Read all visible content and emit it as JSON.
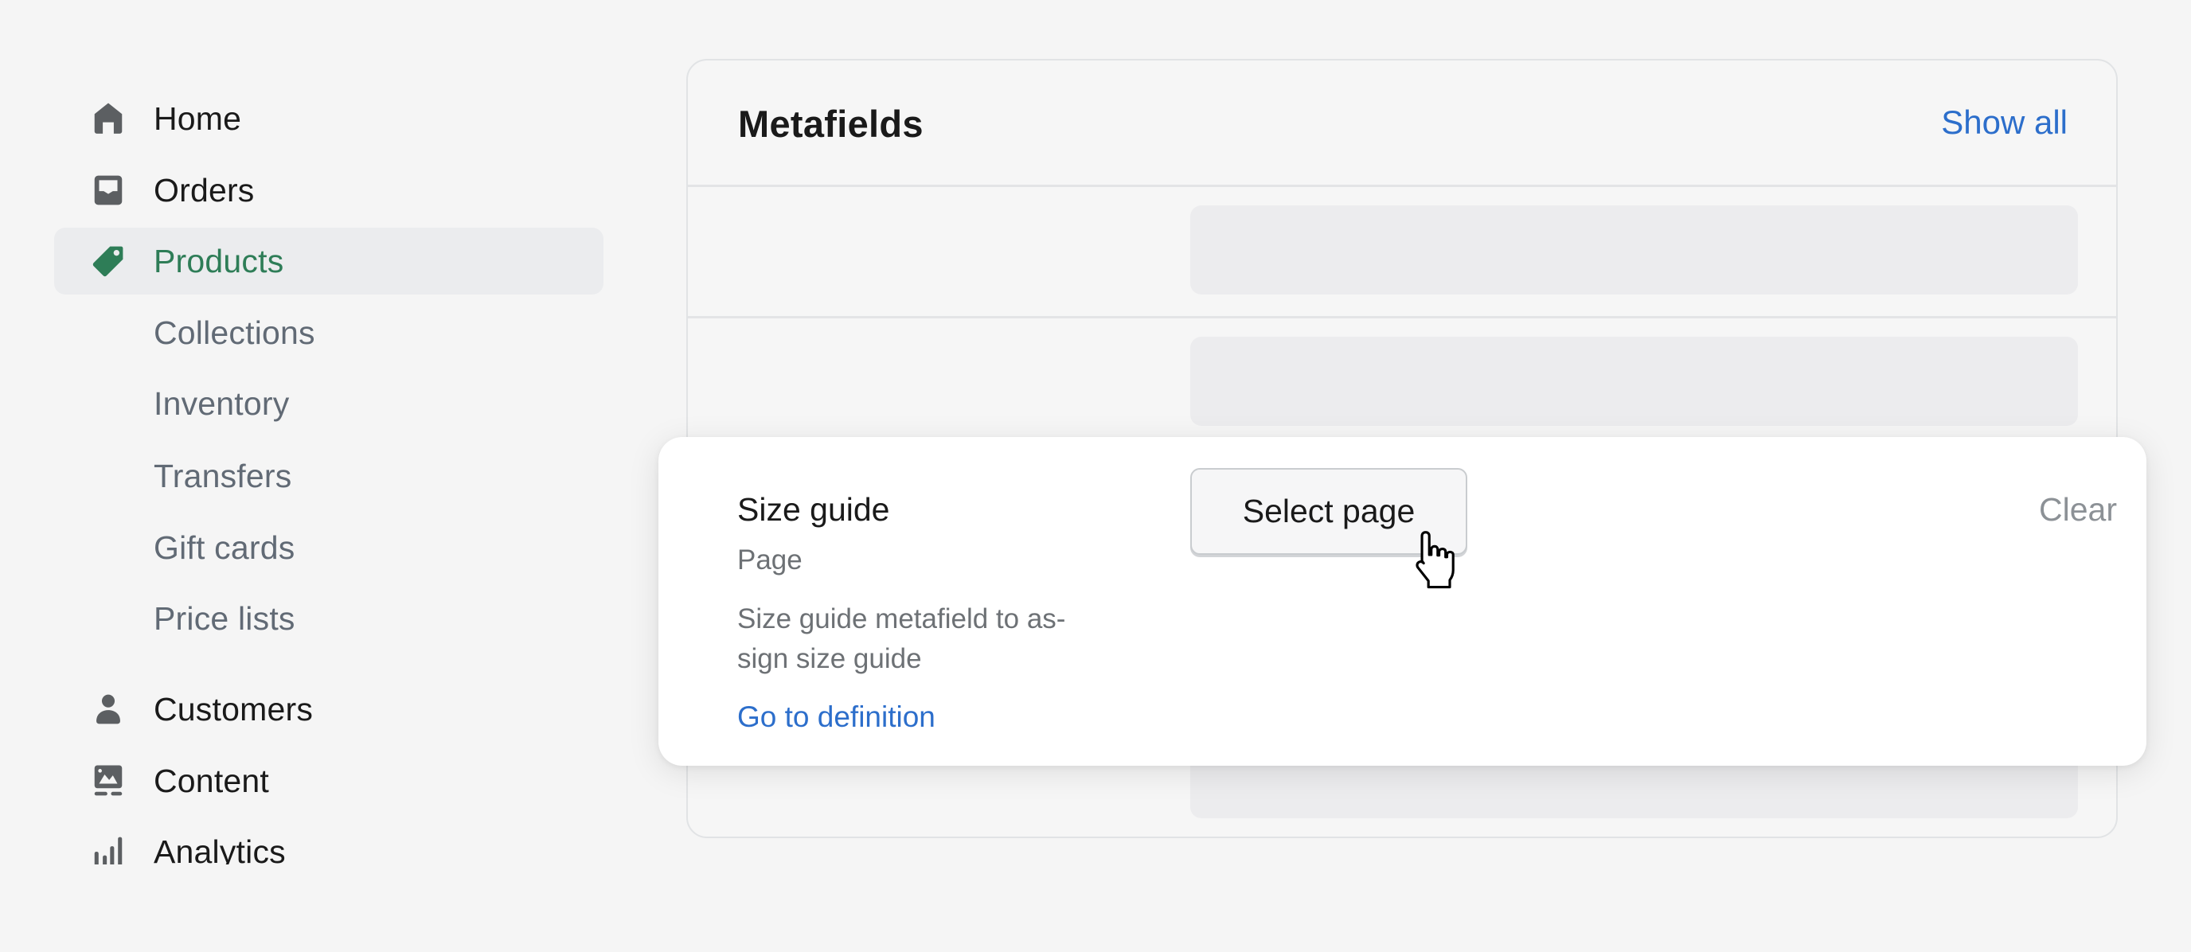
{
  "sidebar": {
    "items": [
      {
        "label": "Home",
        "icon": "home-icon"
      },
      {
        "label": "Orders",
        "icon": "inbox-icon"
      },
      {
        "label": "Products",
        "icon": "tag-icon",
        "active": true
      },
      {
        "label": "Collections"
      },
      {
        "label": "Inventory"
      },
      {
        "label": "Transfers"
      },
      {
        "label": "Gift cards"
      },
      {
        "label": "Price lists"
      },
      {
        "label": "Customers",
        "icon": "person-icon"
      },
      {
        "label": "Content",
        "icon": "image-icon"
      },
      {
        "label": "Analytics",
        "icon": "bar-chart-icon"
      }
    ]
  },
  "card": {
    "title": "Metafields",
    "show_all_label": "Show all"
  },
  "popover": {
    "field_name": "Size guide",
    "field_type": "Page",
    "description": "Size guide metafield to as-sign size guide",
    "description_line1": "Size guide metafield to as-",
    "description_line2": "sign size guide",
    "definition_link": "Go to definition",
    "select_button": "Select page",
    "clear_button": "Clear"
  },
  "colors": {
    "accent_green": "#2e7d57",
    "link_blue": "#2c6ecb",
    "background": "#f5f5f5"
  }
}
